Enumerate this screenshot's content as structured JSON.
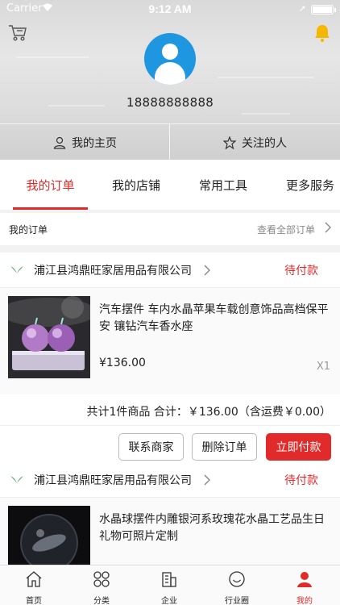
{
  "status_bar": {
    "carrier": "Carrier",
    "time": "9:12 AM"
  },
  "profile": {
    "phone": "18888888888",
    "home_label": "我的主页",
    "follow_label": "关注的人"
  },
  "tabs": [
    {
      "label": "我的订单",
      "active": true
    },
    {
      "label": "我的店铺",
      "active": false
    },
    {
      "label": "常用工具",
      "active": false
    },
    {
      "label": "更多服务",
      "active": false
    }
  ],
  "orders_header": {
    "title": "我的订单",
    "view_all": "查看全部订单"
  },
  "orders": [
    {
      "shop": "浦江县鸿鼎旺家居用品有限公司",
      "status": "待付款",
      "title": "汽车摆件 车内水晶苹果车载创意饰品高档保平安 镶钻汽车香水座",
      "price": "¥136.00",
      "qty": "X1",
      "summary": "共计1件商品 合计：￥136.00（含运费￥0.00）",
      "buttons": [
        "联系商家",
        "删除订单",
        "立即付款"
      ]
    },
    {
      "shop": "浦江县鸿鼎旺家居用品有限公司",
      "status": "待付款",
      "title": "水晶球摆件内雕银河系玫瑰花水晶工艺品生日礼物可照片定制"
    }
  ],
  "tabbar": [
    {
      "label": "首页",
      "icon": "home-icon"
    },
    {
      "label": "分类",
      "icon": "category-icon"
    },
    {
      "label": "企业",
      "icon": "enterprise-icon"
    },
    {
      "label": "行业圈",
      "icon": "smile-icon"
    },
    {
      "label": "我的",
      "icon": "user-icon",
      "active": true
    }
  ],
  "colors": {
    "accent": "#e12a2a",
    "avatar": "#1f97e0",
    "bell": "#f5b800"
  }
}
